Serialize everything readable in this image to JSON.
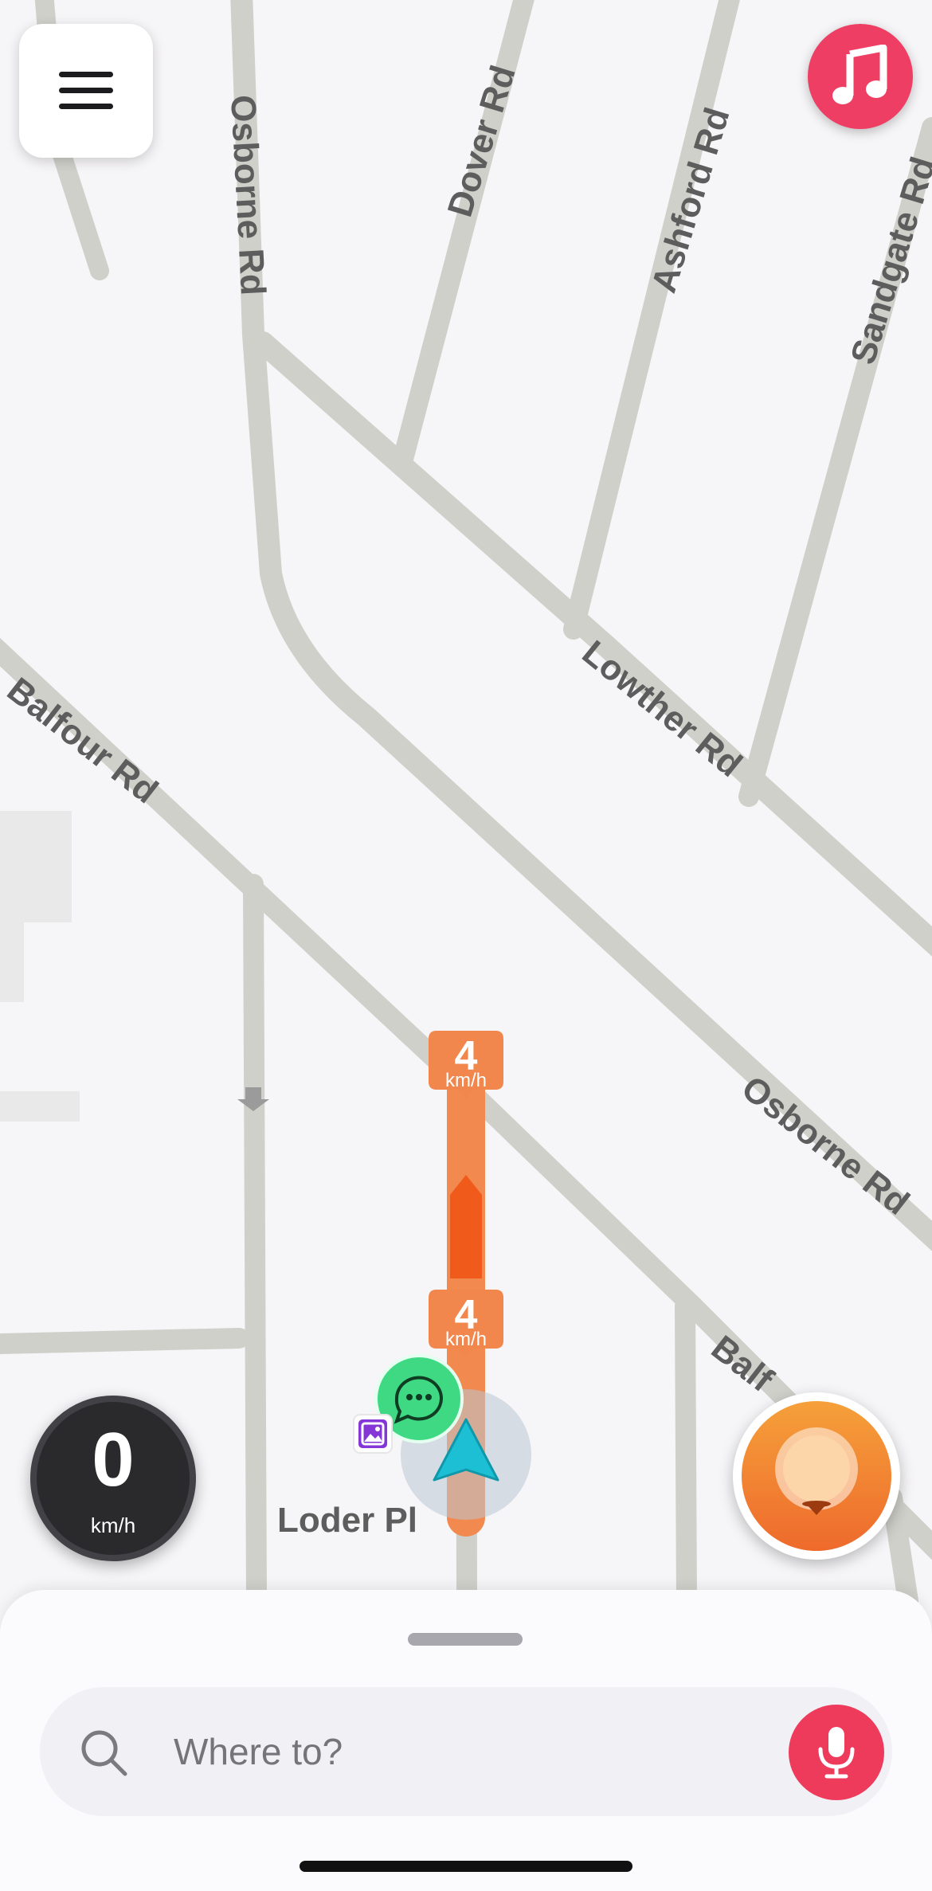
{
  "map": {
    "streets": [
      {
        "id": "osborne-rd-north",
        "label": "Osborne Rd"
      },
      {
        "id": "dover-rd",
        "label": "Dover Rd"
      },
      {
        "id": "ashford-rd",
        "label": "Ashford Rd"
      },
      {
        "id": "sandgate-rd",
        "label": "Sandgate Rd"
      },
      {
        "id": "lowther-rd",
        "label": "Lowther Rd"
      },
      {
        "id": "balfour-rd",
        "label": "Balfour Rd"
      },
      {
        "id": "osborne-rd-south",
        "label": "Osborne Rd"
      },
      {
        "id": "balfour-rd-partial",
        "label": "Balf"
      },
      {
        "id": "loder-pl",
        "label": "Loder Pl"
      }
    ],
    "speed_markers": [
      {
        "value": "4",
        "unit": "km/h"
      },
      {
        "value": "4",
        "unit": "km/h"
      }
    ],
    "colors": {
      "road": "#cfd0ca",
      "traffic_route": "#f28a4f",
      "traffic_heavy": "#f05a1a",
      "position_arrow": "#22c1d6",
      "chat_bubble": "#3fd983"
    }
  },
  "header": {
    "menu_icon": "hamburger-menu-icon",
    "music_icon": "music-note-icon",
    "music_color": "#ef3e63"
  },
  "speedometer": {
    "value": "0",
    "unit": "km/h"
  },
  "report_button": {
    "icon": "report-pin-icon",
    "color": "#ee7a2e"
  },
  "search": {
    "placeholder": "Where to?",
    "search_icon": "search-icon",
    "mic_icon": "microphone-icon",
    "mic_color": "#ee3b5c"
  }
}
